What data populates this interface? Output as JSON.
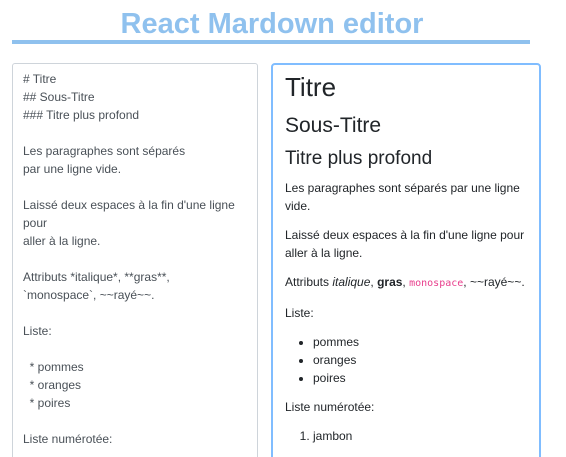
{
  "header": {
    "title": "React Mardown editor"
  },
  "colors": {
    "accent": "#8fc1ee",
    "preview_border": "#80bdff",
    "code": "#e83e8c"
  },
  "editor": {
    "lines": [
      "# Titre",
      "## Sous-Titre",
      "### Titre plus profond",
      "",
      "Les paragraphes sont séparés",
      "par une ligne vide.",
      "",
      "Laissé deux espaces à la fin d'une ligne",
      "pour",
      "aller à la ligne.",
      "",
      "Attributs *italique*, **gras**,",
      "`monospace`, ~~rayé~~.",
      "",
      "Liste:",
      "",
      "  * pommes",
      "  * oranges",
      "  * poires",
      "",
      "Liste numérotée:"
    ]
  },
  "preview": {
    "h1": "Titre",
    "h2": "Sous-Titre",
    "h3": "Titre plus profond",
    "para1": "Les paragraphes sont séparés par une ligne vide.",
    "para2": "Laissé deux espaces à la fin d'une ligne pour aller à la ligne.",
    "attr_prefix": "Attributs ",
    "attr_italic": "italique",
    "attr_sep1": ", ",
    "attr_bold": "gras",
    "attr_sep2": ", ",
    "attr_mono": "monospace",
    "attr_sep3": ", ~~rayé~~.",
    "list_label": "Liste:",
    "list_items": [
      "pommes",
      "oranges",
      "poires"
    ],
    "ordered_label": "Liste numérotée:",
    "ordered_items": [
      "jambon"
    ]
  }
}
